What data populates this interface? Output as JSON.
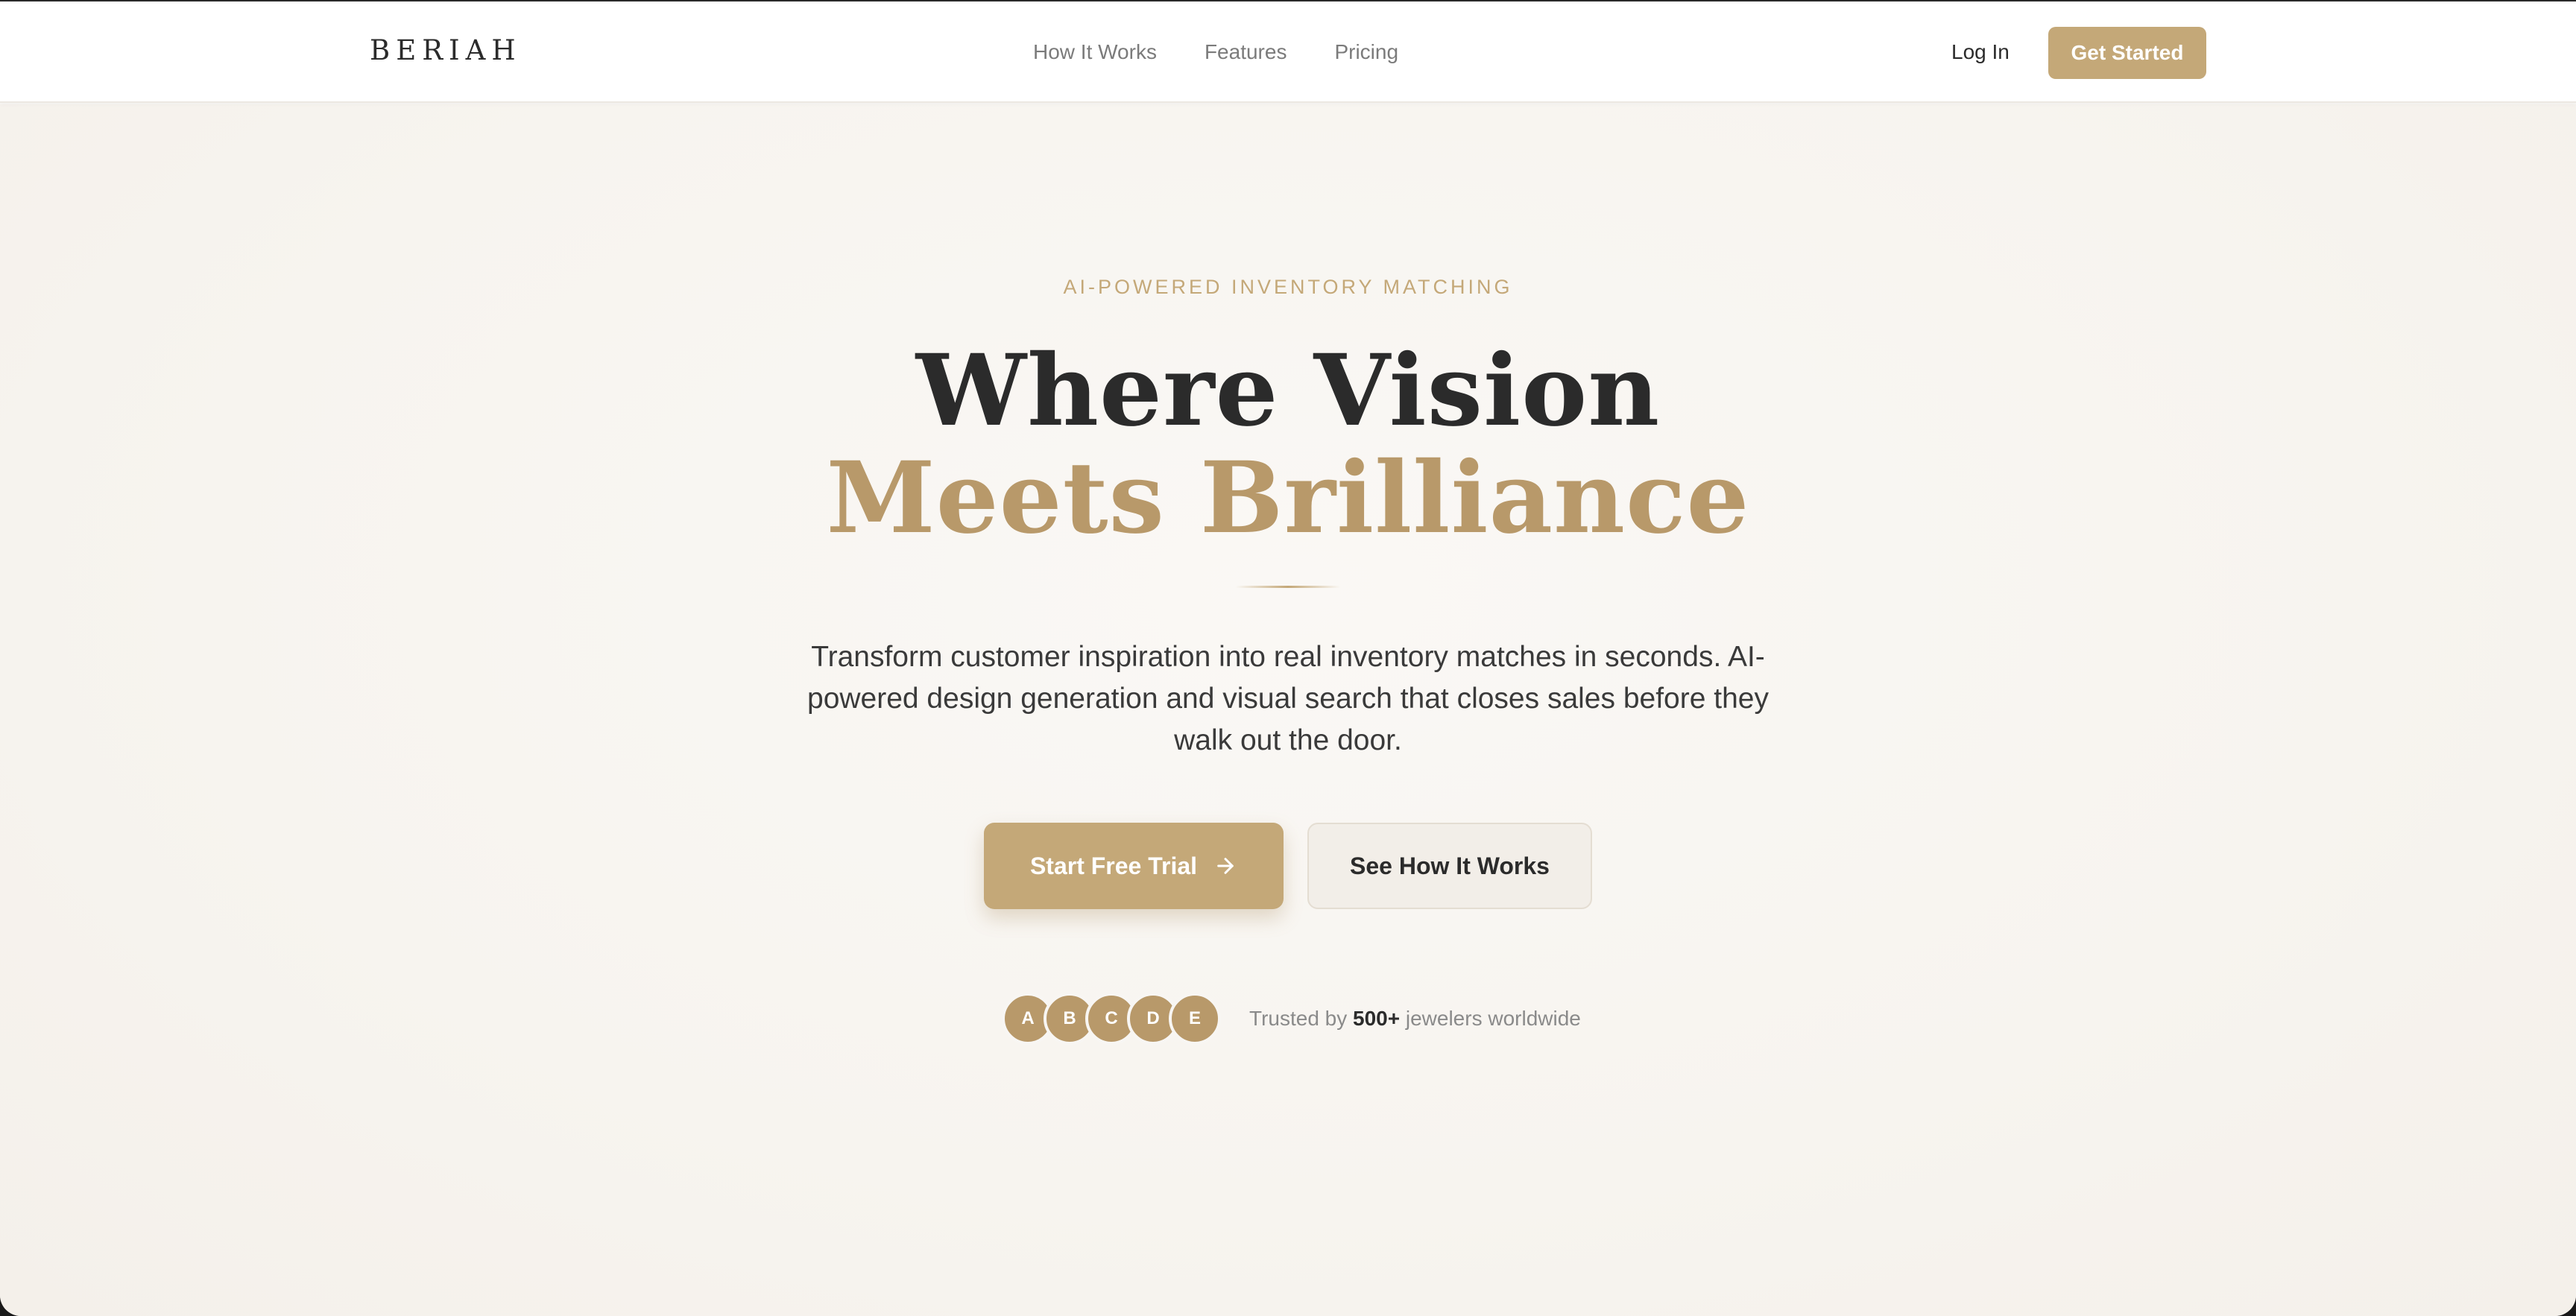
{
  "brand": {
    "logo": "BERIAH",
    "accent_color": "#c4a878",
    "text_color": "#2b2b2b"
  },
  "nav": {
    "links": [
      "How It Works",
      "Features",
      "Pricing"
    ],
    "login_label": "Log In",
    "cta_label": "Get Started"
  },
  "hero": {
    "eyebrow": "AI-POWERED INVENTORY MATCHING",
    "headline_line1": "Where Vision",
    "headline_line2": "Meets Brilliance",
    "lede": "Transform customer inspiration into real inventory matches in seconds. AI-powered design generation and visual search that closes sales before they walk out the door.",
    "primary_button": "Start Free Trial",
    "primary_button_icon": "arrow-right-icon",
    "secondary_button": "See How It Works"
  },
  "trust": {
    "avatars": [
      "A",
      "B",
      "C",
      "D",
      "E"
    ],
    "prefix": "Trusted by ",
    "count": "500+",
    "suffix": " jewelers worldwide"
  }
}
